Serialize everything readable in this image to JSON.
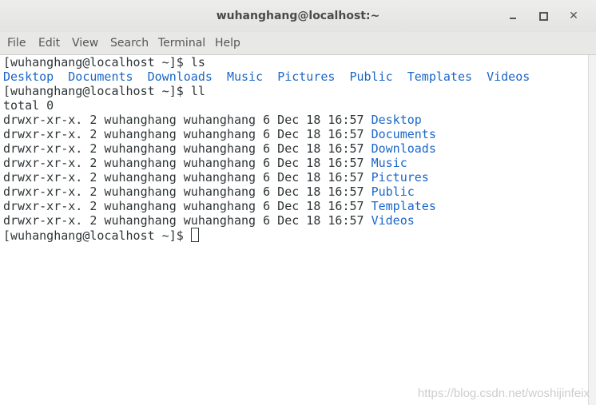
{
  "window": {
    "title": "wuhanghang@localhost:~"
  },
  "menu": [
    "File",
    "Edit",
    "View",
    "Search",
    "Terminal",
    "Help"
  ],
  "prompt": "[wuhanghang@localhost ~]$ ",
  "commands": {
    "first": "ls",
    "second": "ll"
  },
  "ls_output": [
    "Desktop",
    "Documents",
    "Downloads",
    "Music",
    "Pictures",
    "Public",
    "Templates",
    "Videos"
  ],
  "total_line": "total 0",
  "ll_prefix": "drwxr-xr-x. 2 wuhanghang wuhanghang 6 Dec 18 16:57 ",
  "ll_entries": [
    "Desktop",
    "Documents",
    "Downloads",
    "Music",
    "Pictures",
    "Public",
    "Templates",
    "Videos"
  ],
  "watermark": "https://blog.csdn.net/woshijinfeix",
  "colors": {
    "directory": "#1a66c9",
    "text": "#2e3436",
    "terminal_bg": "#ffffff",
    "chrome_bg": "#e8e8e7"
  },
  "icons": {
    "minimize": "minimize-icon",
    "maximize": "maximize-icon",
    "close": "close-icon"
  }
}
